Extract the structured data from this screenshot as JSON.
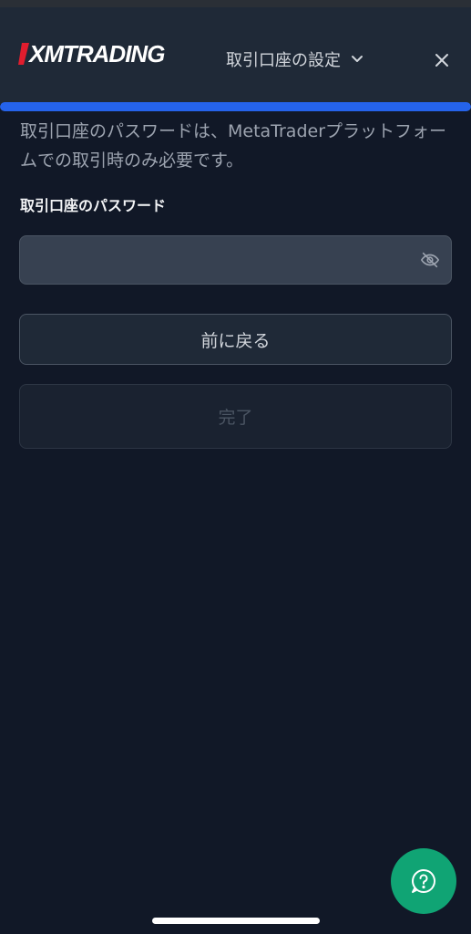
{
  "header": {
    "logo_text": "XMTRADING",
    "title": "取引口座の設定"
  },
  "progress": {
    "value": 1.0
  },
  "form": {
    "description": "取引口座のパスワードは、MetaTraderプラットフォームでの取引時のみ必要です。",
    "password_label": "取引口座のパスワード",
    "password_value": ""
  },
  "buttons": {
    "back_label": "前に戻る",
    "done_label": "完了"
  },
  "icons": {
    "close": "close-icon",
    "chevron": "chevron-down-icon",
    "eye": "eye-off-icon",
    "help": "help-icon"
  },
  "colors": {
    "accent": "#2563eb",
    "help": "#10a474",
    "logo_red": "#e11d2e"
  }
}
